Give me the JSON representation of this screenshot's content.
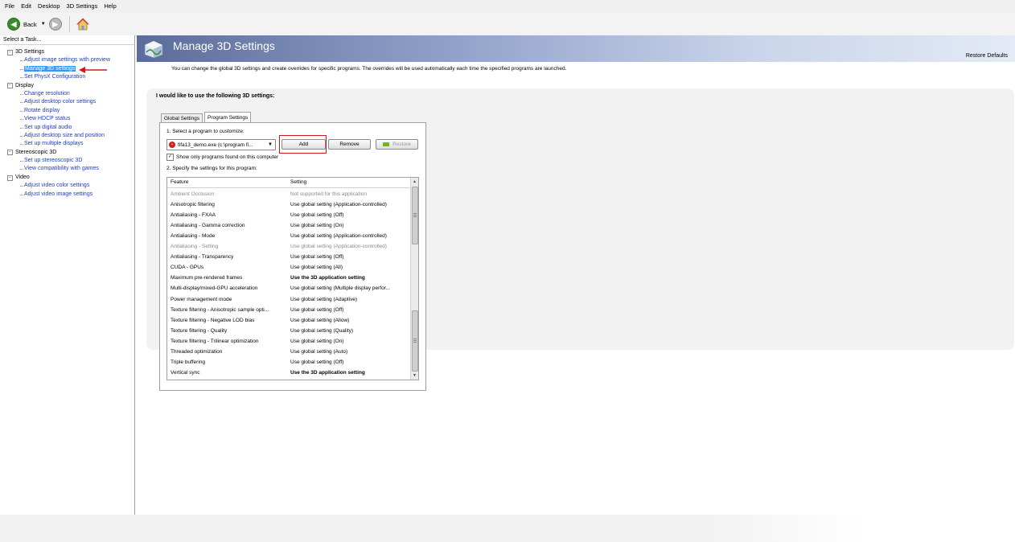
{
  "menu": [
    "File",
    "Edit",
    "Desktop",
    "3D Settings",
    "Help"
  ],
  "toolbar": {
    "back_label": "Back"
  },
  "left_panel": {
    "header": "Select a Task...",
    "tree": [
      {
        "label": "3D Settings",
        "children": [
          "Adjust image settings with preview",
          "Manage 3D settings",
          "Set PhysX Configuration"
        ]
      },
      {
        "label": "Display",
        "children": [
          "Change resolution",
          "Adjust desktop color settings",
          "Rotate display",
          "View HDCP status",
          "Set up digital audio",
          "Adjust desktop size and position",
          "Set up multiple displays"
        ]
      },
      {
        "label": "Stereoscopic 3D",
        "children": [
          "Set up stereoscopic 3D",
          "View compatibility with games"
        ]
      },
      {
        "label": "Video",
        "children": [
          "Adjust video color settings",
          "Adjust video image settings"
        ]
      }
    ],
    "selected": "Manage 3D settings"
  },
  "page": {
    "title": "Manage 3D Settings",
    "restore_defaults": "Restore Defaults",
    "description": "You can change the global 3D settings and create overrides for specific programs. The overrides will be used automatically each time the specified programs are launched.",
    "settings_heading": "I would like to use the following 3D settings:",
    "tabs": [
      "Global Settings",
      "Program Settings"
    ],
    "active_tab": "Program Settings",
    "step1_label": "1. Select a program to customize:",
    "program_value": "fifa13_demo.exe (c:\\program fi...",
    "buttons": {
      "add": "Add",
      "remove": "Remove",
      "restore": "Restore"
    },
    "checkbox_label": "Show only programs found on this computer",
    "checkbox_checked": "✓",
    "step2_label": "2. Specify the settings for this program:",
    "table": {
      "headers": [
        "Feature",
        "Setting"
      ],
      "rows": [
        {
          "feature": "Ambient Occlusion",
          "setting": "Not supported for this application",
          "state": "disabled"
        },
        {
          "feature": "Anisotropic filtering",
          "setting": "Use global setting (Application-controlled)",
          "state": "normal"
        },
        {
          "feature": "Antialiasing - FXAA",
          "setting": "Use global setting (Off)",
          "state": "normal"
        },
        {
          "feature": "Antialiasing - Gamma correction",
          "setting": "Use global setting (On)",
          "state": "normal"
        },
        {
          "feature": "Antialiasing - Mode",
          "setting": "Use global setting (Application-controlled)",
          "state": "normal"
        },
        {
          "feature": "Antialiasing - Setting",
          "setting": "Use global setting (Application-controlled)",
          "state": "disabled"
        },
        {
          "feature": "Antialiasing - Transparency",
          "setting": "Use global setting (Off)",
          "state": "normal"
        },
        {
          "feature": "CUDA - GPUs",
          "setting": "Use global setting (All)",
          "state": "normal"
        },
        {
          "feature": "Maximum pre-rendered frames",
          "setting": "Use the 3D application setting",
          "state": "bold"
        },
        {
          "feature": "Multi-display/mixed-GPU acceleration",
          "setting": "Use global setting (Multiple display perfor...",
          "state": "normal"
        },
        {
          "feature": "Power management mode",
          "setting": "Use global setting (Adaptive)",
          "state": "normal"
        },
        {
          "feature": "Texture filtering - Anisotropic sample opti...",
          "setting": "Use global setting (Off)",
          "state": "normal"
        },
        {
          "feature": "Texture filtering - Negative LOD bias",
          "setting": "Use global setting (Allow)",
          "state": "normal"
        },
        {
          "feature": "Texture filtering - Quality",
          "setting": "Use global setting (Quality)",
          "state": "normal"
        },
        {
          "feature": "Texture filtering - Trilinear optimization",
          "setting": "Use global setting (On)",
          "state": "normal"
        },
        {
          "feature": "Threaded optimization",
          "setting": "Use global setting (Auto)",
          "state": "normal"
        },
        {
          "feature": "Triple buffering",
          "setting": "Use global setting (Off)",
          "state": "normal"
        },
        {
          "feature": "Vertical sync",
          "setting": "Use the 3D application setting",
          "state": "bold"
        }
      ]
    }
  },
  "colors": {
    "banner": "#5b6c9a",
    "link": "#2040c0",
    "selection": "#3399ff",
    "highlight_box": "#d01818",
    "nvidia_green": "#76b900"
  }
}
